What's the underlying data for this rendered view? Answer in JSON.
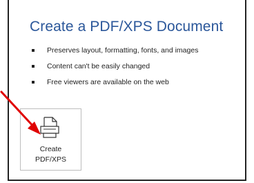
{
  "header": {
    "title": "Create a PDF/XPS Document"
  },
  "bullets": [
    "Preserves layout, formatting, fonts, and images",
    "Content can't be easily changed",
    "Free viewers are available on the web"
  ],
  "create_button": {
    "line1": "Create",
    "line2": "PDF/XPS",
    "icon": "pdf-document-icon"
  },
  "annotation": {
    "arrow_color": "#e00000"
  },
  "colors": {
    "title": "#2b579a"
  }
}
